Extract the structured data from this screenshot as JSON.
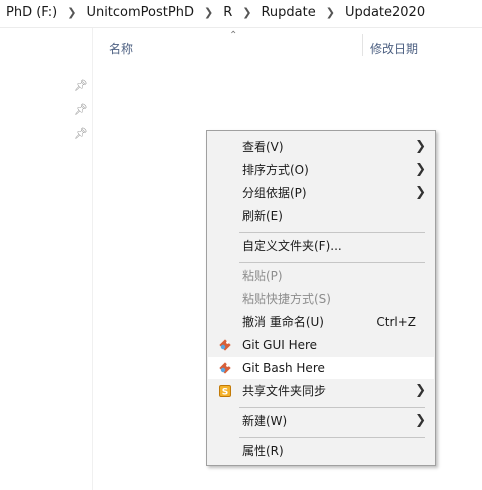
{
  "breadcrumb": [
    "PhD (F:)",
    "UnitcomPostPhD",
    "R",
    "Rupdate",
    "Update2020"
  ],
  "columns": {
    "name": "名称",
    "date": "修改日期"
  },
  "icons": {
    "separator": "chevron-right-icon",
    "pin": "pin-icon",
    "sort": "sort-up-icon",
    "submenu": "chevron-right-icon",
    "git": "git-icon",
    "share": "sync-share-icon"
  },
  "context_menu": {
    "view": "查看(V)",
    "sort_by": "排序方式(O)",
    "group_by": "分组依据(P)",
    "refresh": "刷新(E)",
    "customize_folder": "自定义文件夹(F)...",
    "paste": "粘贴(P)",
    "paste_shortcut": "粘贴快捷方式(S)",
    "undo_rename": "撤消 重命名(U)",
    "undo_shortcut": "Ctrl+Z",
    "git_gui": "Git GUI Here",
    "git_bash": "Git Bash Here",
    "sync_shared_folder": "共享文件夹同步",
    "new": "新建(W)",
    "properties": "属性(R)"
  }
}
